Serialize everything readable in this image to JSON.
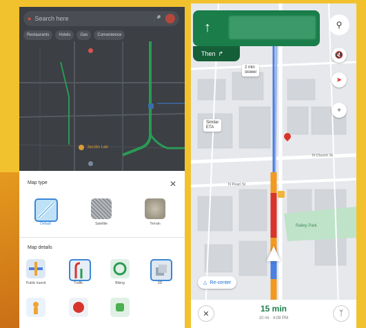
{
  "left": {
    "search_placeholder": "Search here",
    "chips": [
      "Restaurants",
      "Hotels",
      "Gas",
      "Convenience"
    ],
    "poi": "Jacobs Lab",
    "sheet": {
      "map_type_title": "Map type",
      "types": [
        "Default",
        "Satellite",
        "Terrain"
      ],
      "details_title": "Map details",
      "details": [
        "Public transit",
        "Traffic",
        "Biking",
        "3D"
      ]
    }
  },
  "right": {
    "then_label": "Then",
    "callout_slower": [
      "2 min",
      "slower"
    ],
    "callout_similar": [
      "Similar",
      "ETA"
    ],
    "streets": [
      "N Church St",
      "N Pearl St",
      "Railey Park"
    ],
    "recenter_label": "Re-center",
    "eta_time": "15 min",
    "eta_detail": "10 mi · 4:08 PM",
    "colors": {
      "nav_green": "#1a7d4a",
      "route_blue": "#4b7fe0",
      "traffic_orange": "#f19a22",
      "traffic_red": "#d9342b"
    }
  },
  "icons": {
    "mic": "mic-icon",
    "close": "close-icon",
    "search": "search-icon",
    "mute": "mute-icon",
    "compass": "compass-icon",
    "report": "report-icon",
    "alternate_routes": "routes-icon",
    "pin": "pin-icon",
    "recenter": "navigation-arrow-icon"
  }
}
